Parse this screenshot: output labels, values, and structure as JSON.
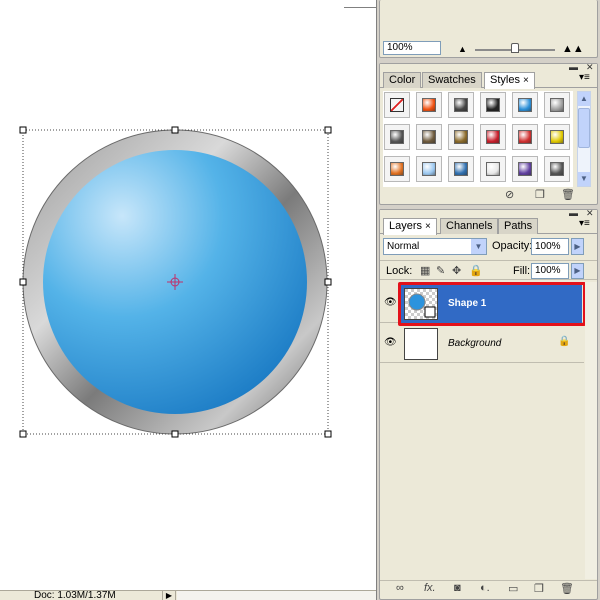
{
  "canvas": {
    "circle_colors": {
      "fill_light": "#c7e6fa",
      "fill_mid": "#54b3e8",
      "fill_dark": "#1a7ac4",
      "rim_light": "#e8e8e8",
      "rim_dark": "#6a6a6a",
      "center_marker": "#c0306a"
    }
  },
  "status_bar": {
    "doc_info": "Doc: 1.03M/1.37M",
    "arrow": "▶"
  },
  "navigator": {
    "zoom_value": "100%"
  },
  "styles_panel": {
    "tabs": [
      {
        "label": "Color",
        "active": false
      },
      {
        "label": "Swatches",
        "active": false
      },
      {
        "label": "Styles",
        "active": true,
        "close": "×"
      }
    ],
    "swatches": [
      {
        "name": "none-style",
        "color": "#ffffff"
      },
      {
        "name": "fire-style",
        "color": "#f05010"
      },
      {
        "name": "dark-gray-style",
        "color": "#444444"
      },
      {
        "name": "black-button-style",
        "color": "#222222"
      },
      {
        "name": "blue-glass-style",
        "color": "#2b8fd8"
      },
      {
        "name": "gray-style",
        "color": "#a0a0a0"
      },
      {
        "name": "dark-bevel-style",
        "color": "#555555"
      },
      {
        "name": "brown-style",
        "color": "#6e5a3c"
      },
      {
        "name": "bronze-style",
        "color": "#8a6a2a"
      },
      {
        "name": "red-stripes-style",
        "color": "#c81e2a"
      },
      {
        "name": "multicolor-style",
        "color": "#d03030"
      },
      {
        "name": "yellow-style",
        "color": "#e0c800"
      },
      {
        "name": "orange-gradient-style",
        "color": "#e07020"
      },
      {
        "name": "light-blue-style",
        "color": "#9cc8f0"
      },
      {
        "name": "sunset-style",
        "color": "#3070b0"
      },
      {
        "name": "white-check-style",
        "color": "#e8e8e8"
      },
      {
        "name": "purple-style",
        "color": "#6040a0"
      },
      {
        "name": "charcoal-style",
        "color": "#555555"
      }
    ]
  },
  "layers_panel": {
    "tabs": [
      {
        "label": "Layers",
        "active": true,
        "close": "×"
      },
      {
        "label": "Channels",
        "active": false
      },
      {
        "label": "Paths",
        "active": false
      }
    ],
    "blend_mode": "Normal",
    "opacity_label": "Opacity:",
    "opacity_value": "100%",
    "lock_label": "Lock:",
    "fill_label": "Fill:",
    "fill_value": "100%",
    "layers": [
      {
        "name": "Shape 1",
        "selected": true,
        "visible": true
      },
      {
        "name": "Background",
        "selected": false,
        "visible": true,
        "locked": true
      }
    ],
    "selection_highlight_color": "#e3111a",
    "selected_row_color": "#316ac5"
  }
}
